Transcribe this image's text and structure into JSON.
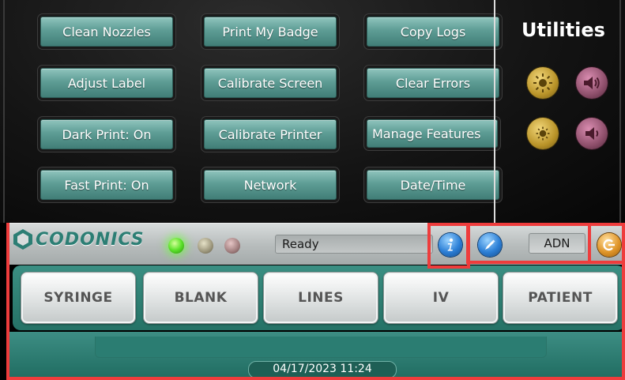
{
  "utilities": {
    "title": "Utilities",
    "buttons": [
      [
        "Clean Nozzles",
        "Print My Badge",
        "Copy Logs"
      ],
      [
        "Adjust Label",
        "Calibrate Screen",
        "Clear Errors"
      ],
      [
        "Dark Print: On",
        "Calibrate Printer",
        "Manage Features"
      ],
      [
        "Fast Print: On",
        "Network",
        "Date/Time"
      ]
    ],
    "side_icons": [
      "brightness-up-icon",
      "volume-up-icon",
      "brightness-down-icon",
      "volume-down-icon"
    ]
  },
  "status_bar": {
    "logo": "CODONICS",
    "status_text": "Ready",
    "indicator_lights": [
      "green-on",
      "yellow-off",
      "red-off"
    ],
    "user": "ADN",
    "icons": [
      "info-icon",
      "utilities-icon",
      "logout-icon"
    ]
  },
  "templates": [
    "SYRINGE",
    "BLANK",
    "LINES",
    "IV",
    "PATIENT"
  ],
  "footer": {
    "datetime": "04/17/2023 11:24"
  },
  "colors": {
    "accent": "#2c7e74",
    "highlight": "#ee3c3c",
    "util_button": "#5e9d95"
  }
}
